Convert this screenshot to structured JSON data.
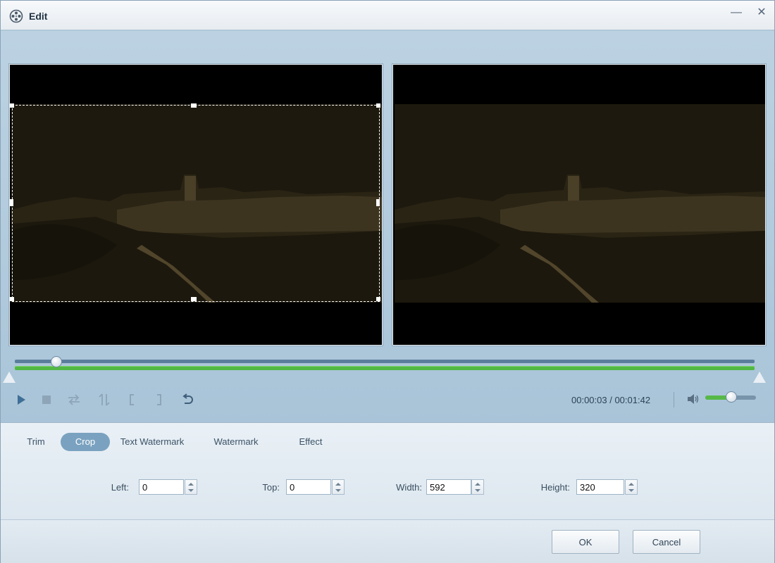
{
  "window": {
    "title": "Edit",
    "minimize_glyph": "—",
    "close_glyph": "✕"
  },
  "icons": {
    "app": "film-reel-icon",
    "play": "play-icon",
    "stop": "stop-icon",
    "swap": "swap-arrows-icon",
    "split": "split-icon",
    "mark_in": "mark-in-bracket-icon",
    "mark_out": "mark-out-bracket-icon",
    "reset": "undo-icon",
    "volume": "speaker-icon"
  },
  "colors": {
    "accent": "#7aa2c0",
    "progress": "#52b844",
    "crop_border": "#ffffff"
  },
  "player": {
    "current_time": "00:00:03",
    "total_time": "00:01:42",
    "time_display": "00:00:03 / 00:01:42",
    "playhead_fraction": 0.03,
    "volume_fraction": 0.52
  },
  "tabs": [
    {
      "label": "Trim",
      "active": false
    },
    {
      "label": "Crop",
      "active": true
    },
    {
      "label": "Text Watermark",
      "active": false
    },
    {
      "label": "Watermark",
      "active": false
    },
    {
      "label": "Effect",
      "active": false
    }
  ],
  "crop": {
    "left": {
      "label": "Left:",
      "value": "0"
    },
    "top": {
      "label": "Top:",
      "value": "0"
    },
    "width": {
      "label": "Width:",
      "value": "592"
    },
    "height": {
      "label": "Height:",
      "value": "320"
    }
  },
  "buttons": {
    "ok": "OK",
    "cancel": "Cancel"
  }
}
